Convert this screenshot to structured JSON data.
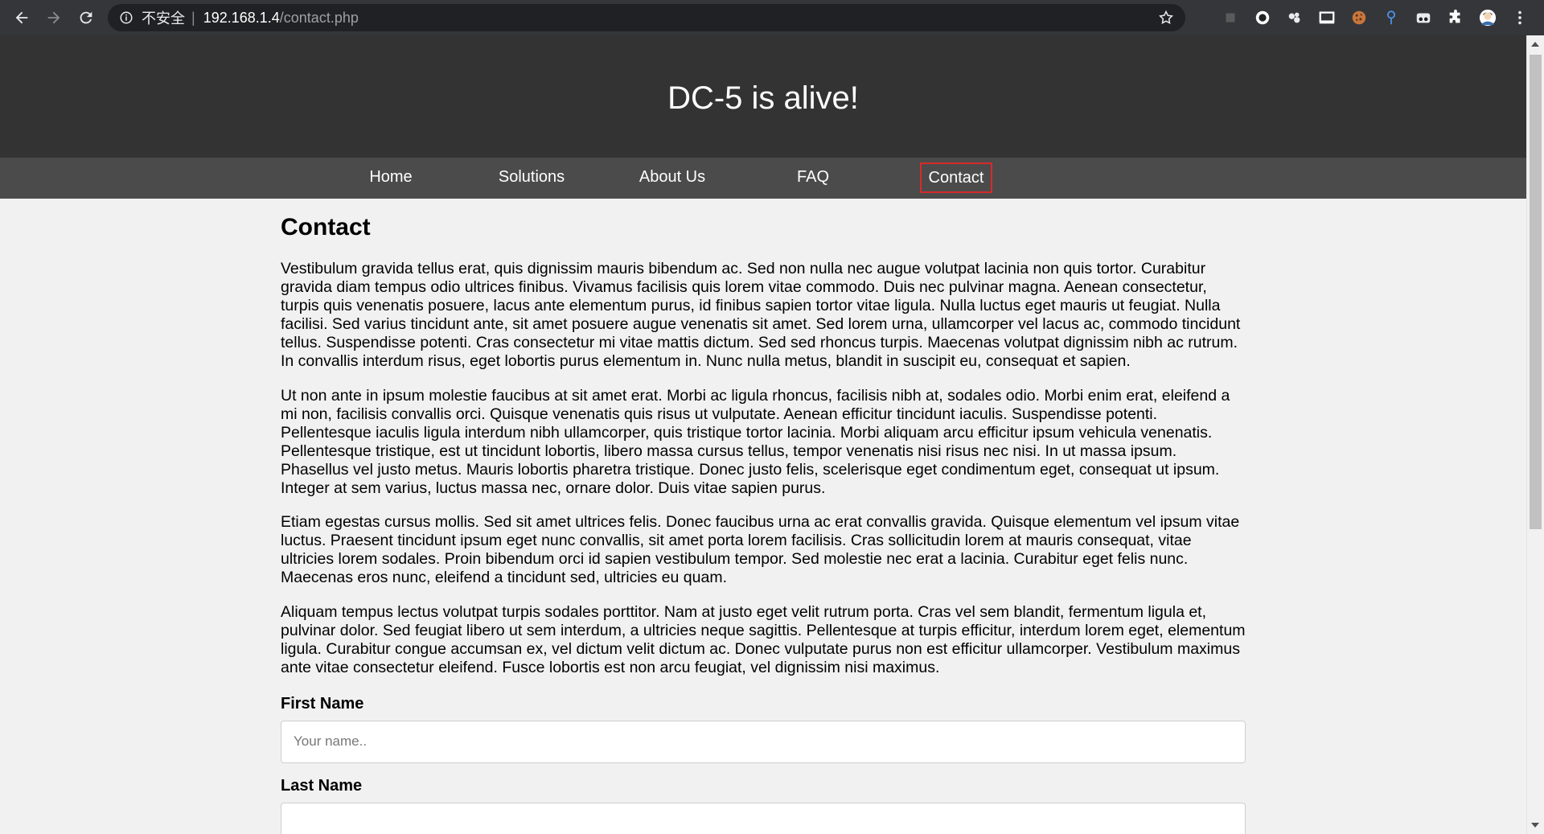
{
  "browser": {
    "security_text": "不安全",
    "separator": "|",
    "url_host": "192.168.1.4",
    "url_path": "/contact.php",
    "extensions": [
      "extension-square-icon",
      "record-icon",
      "puzzle-cluster-icon",
      "screen-icon",
      "cookie-icon",
      "pin-icon",
      "mask-icon",
      "extensions-puzzle-icon",
      "profile-avatar",
      "more-icon"
    ]
  },
  "site": {
    "title": "DC-5 is alive!",
    "nav": [
      {
        "label": "Home"
      },
      {
        "label": "Solutions"
      },
      {
        "label": "About Us"
      },
      {
        "label": "FAQ"
      },
      {
        "label": "Contact"
      }
    ],
    "active_nav": "Contact"
  },
  "content": {
    "heading": "Contact",
    "paragraphs": [
      "Vestibulum gravida tellus erat, quis dignissim mauris bibendum ac. Sed non nulla nec augue volutpat lacinia non quis tortor. Curabitur gravida diam tempus odio ultrices finibus. Vivamus facilisis quis lorem vitae commodo. Duis nec pulvinar magna. Aenean consectetur, turpis quis venenatis posuere, lacus ante elementum purus, id finibus sapien tortor vitae ligula. Nulla luctus eget mauris ut feugiat. Nulla facilisi. Sed varius tincidunt ante, sit amet posuere augue venenatis sit amet. Sed lorem urna, ullamcorper vel lacus ac, commodo tincidunt tellus. Suspendisse potenti. Cras consectetur mi vitae mattis dictum. Sed sed rhoncus turpis. Maecenas volutpat dignissim nibh ac rutrum. In convallis interdum risus, eget lobortis purus elementum in. Nunc nulla metus, blandit in suscipit eu, consequat et sapien.",
      "Ut non ante in ipsum molestie faucibus at sit amet erat. Morbi ac ligula rhoncus, facilisis nibh at, sodales odio. Morbi enim erat, eleifend a mi non, facilisis convallis orci. Quisque venenatis quis risus ut vulputate. Aenean efficitur tincidunt iaculis. Suspendisse potenti. Pellentesque iaculis ligula interdum nibh ullamcorper, quis tristique tortor lacinia. Morbi aliquam arcu efficitur ipsum vehicula venenatis. Pellentesque tristique, est ut tincidunt lobortis, libero massa cursus tellus, tempor venenatis nisi risus nec nisi. In ut massa ipsum. Phasellus vel justo metus. Mauris lobortis pharetra tristique. Donec justo felis, scelerisque eget condimentum eget, consequat ut ipsum. Integer at sem varius, luctus massa nec, ornare dolor. Duis vitae sapien purus.",
      "Etiam egestas cursus mollis. Sed sit amet ultrices felis. Donec faucibus urna ac erat convallis gravida. Quisque elementum vel ipsum vitae luctus. Praesent tincidunt ipsum eget nunc convallis, sit amet porta lorem facilisis. Cras sollicitudin lorem at mauris consequat, vitae ultricies lorem sodales. Proin bibendum orci id sapien vestibulum tempor. Sed molestie nec erat a lacinia. Curabitur eget felis nunc. Maecenas eros nunc, eleifend a tincidunt sed, ultricies eu quam.",
      "Aliquam tempus lectus volutpat turpis sodales porttitor. Nam at justo eget velit rutrum porta. Cras vel sem blandit, fermentum ligula et, pulvinar dolor. Sed feugiat libero ut sem interdum, a ultricies neque sagittis. Pellentesque at turpis efficitur, interdum lorem eget, elementum ligula. Curabitur congue accumsan ex, vel dictum velit dictum ac. Donec vulputate purus non est efficitur ullamcorper. Vestibulum maximus ante vitae consectetur eleifend. Fusce lobortis est non arcu feugiat, vel dignissim nisi maximus."
    ]
  },
  "form": {
    "first_name_label": "First Name",
    "first_name_placeholder": "Your name..",
    "first_name_value": "",
    "last_name_label": "Last Name",
    "last_name_value": ""
  },
  "colors": {
    "browser_bar": "#35363a",
    "header_bg": "#333333",
    "nav_bg": "#4b4b4b",
    "active_border": "#d62a2a",
    "page_bg": "#f1f1f1"
  }
}
